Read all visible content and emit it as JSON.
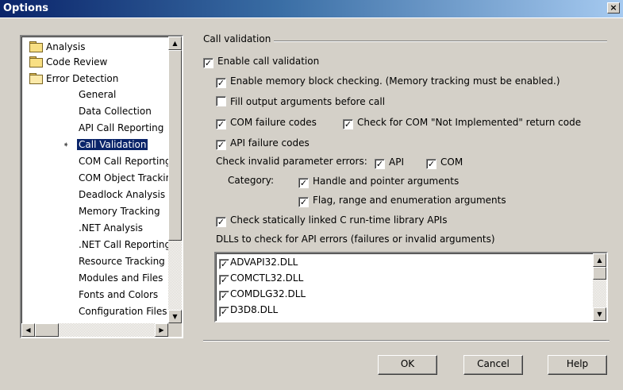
{
  "window": {
    "title": "Options",
    "close_glyph": "×"
  },
  "tree": {
    "items": [
      {
        "label": "Analysis"
      },
      {
        "label": "Code Review"
      },
      {
        "label": "Error Detection"
      },
      {
        "label": "General"
      },
      {
        "label": "Data Collection"
      },
      {
        "label": "API Call Reporting"
      },
      {
        "label": "Call Validation",
        "selected": true
      },
      {
        "label": "COM Call Reporting"
      },
      {
        "label": "COM Object Tracking"
      },
      {
        "label": "Deadlock Analysis"
      },
      {
        "label": "Memory Tracking"
      },
      {
        ".NET Analysis": null,
        "label": ".NET Analysis"
      },
      {
        "label": ".NET Call Reporting"
      },
      {
        "label": "Resource Tracking"
      },
      {
        "label": "Modules and Files"
      },
      {
        "label": "Fonts and Colors"
      },
      {
        "label": "Configuration Files"
      }
    ]
  },
  "call_validation": {
    "group_title": "Call validation",
    "enable_call_validation": {
      "label": "Enable call validation",
      "checked": true
    },
    "enable_memory_block": {
      "label": "Enable memory block checking.  (Memory tracking must be enabled.)",
      "checked": true
    },
    "fill_output_args": {
      "label": "Fill output arguments before call",
      "checked": false
    },
    "com_failure_codes": {
      "label": "COM failure codes",
      "checked": true
    },
    "com_not_implemented": {
      "label": "Check for COM \"Not Implemented\" return code",
      "checked": true
    },
    "api_failure_codes": {
      "label": "API failure codes",
      "checked": true
    },
    "invalid_params_label": "Check invalid parameter errors:",
    "invalid_api": {
      "label": "API",
      "checked": true
    },
    "invalid_com": {
      "label": "COM",
      "checked": true
    },
    "category_label": "Category:",
    "handle_pointer": {
      "label": "Handle and pointer arguments",
      "checked": true
    },
    "flag_range": {
      "label": "Flag, range and enumeration arguments",
      "checked": true
    },
    "static_crt": {
      "label": "Check statically linked C run-time library APIs",
      "checked": true
    },
    "dll_list_label": "DLLs to check for API errors (failures or invalid arguments)",
    "dlls": [
      {
        "name": "ADVAPI32.DLL",
        "checked": true
      },
      {
        "name": "COMCTL32.DLL",
        "checked": true
      },
      {
        "name": "COMDLG32.DLL",
        "checked": true
      },
      {
        "name": "D3D8.DLL",
        "checked": true
      }
    ],
    "check_glyph": "✓"
  },
  "buttons": {
    "ok": "OK",
    "cancel": "Cancel",
    "help": "Help"
  }
}
